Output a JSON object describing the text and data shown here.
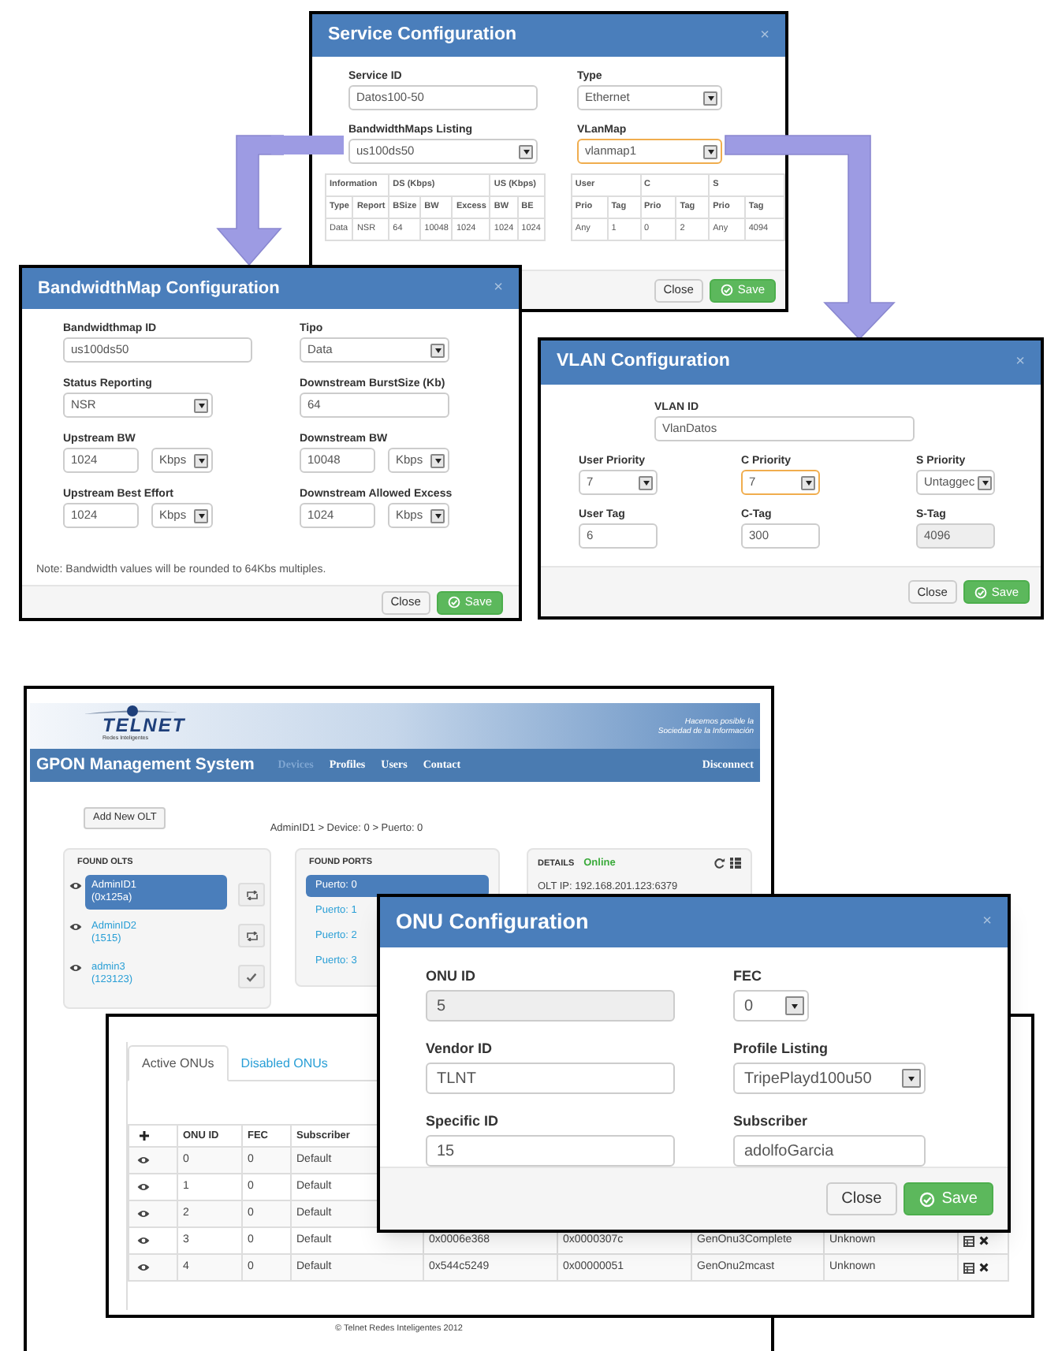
{
  "service_dialog": {
    "title": "Service Configuration",
    "close": "×",
    "fields": [
      {
        "label": "Service ID",
        "value": "Datos100-50",
        "kind": "input",
        "focused": false
      },
      {
        "label": "Type",
        "value": "Ethernet",
        "kind": "select",
        "focused": false
      },
      {
        "label": "BandwidthMaps Listing",
        "value": "us100ds50",
        "kind": "select",
        "focused": false
      },
      {
        "label": "VLanMap",
        "value": "vlanmap1",
        "kind": "select",
        "focused": true
      }
    ],
    "bandwidth_table": {
      "groups": [
        {
          "label": "Information",
          "columns": [
            "Type",
            "Report"
          ]
        },
        {
          "label": "DS (Kbps)",
          "columns": [
            "BSize",
            "BW",
            "Excess"
          ]
        },
        {
          "label": "US (Kbps)",
          "columns": [
            "BW",
            "BE"
          ]
        }
      ],
      "row": [
        "Data",
        "NSR",
        "64",
        "10048",
        "1024",
        "1024",
        "1024"
      ]
    },
    "vlan_table": {
      "groups": [
        {
          "label": "User",
          "columns": [
            "Prio",
            "Tag"
          ]
        },
        {
          "label": "C",
          "columns": [
            "Prio",
            "Tag"
          ]
        },
        {
          "label": "S",
          "columns": [
            "Prio",
            "Tag"
          ]
        }
      ],
      "row": [
        "Any",
        "1",
        "0",
        "2",
        "Any",
        "4094"
      ]
    },
    "buttons": [
      {
        "label": "Close",
        "kind": "default"
      },
      {
        "label": "Save",
        "kind": "primary"
      }
    ]
  },
  "bandwidthmap_dialog": {
    "title": "BandwidthMap Configuration",
    "close": "×",
    "fields": [
      {
        "label": "Bandwidthmap ID",
        "value": "us100ds50",
        "kind": "input"
      },
      {
        "label": "Tipo",
        "value": "Data",
        "kind": "select"
      },
      {
        "label": "Status Reporting",
        "value": "NSR",
        "kind": "select"
      },
      {
        "label": "Downstream BurstSize (Kb)",
        "value": "64",
        "kind": "input"
      },
      {
        "label": "Upstream BW",
        "value": "1024",
        "unit": "Kbps",
        "kind": "input_unit"
      },
      {
        "label": "Downstream BW",
        "value": "10048",
        "unit": "Kbps",
        "kind": "input_unit"
      },
      {
        "label": "Upstream Best Effort",
        "value": "1024",
        "unit": "Kbps",
        "kind": "input_unit"
      },
      {
        "label": "Downstream Allowed Excess",
        "value": "1024",
        "unit": "Kbps",
        "kind": "input_unit"
      }
    ],
    "note": "Note: Bandwidth values will be rounded to 64Kbs multiples.",
    "buttons": [
      {
        "label": "Close",
        "kind": "default"
      },
      {
        "label": "Save",
        "kind": "primary"
      }
    ]
  },
  "vlan_dialog": {
    "title": "VLAN Configuration",
    "close": "×",
    "fields": [
      {
        "label": "VLAN ID",
        "value": "VlanDatos",
        "kind": "input",
        "focused": false,
        "disabled": false
      },
      {
        "label": "User Priority",
        "value": "7",
        "kind": "select",
        "focused": false,
        "disabled": false
      },
      {
        "label": "C Priority",
        "value": "7",
        "kind": "select",
        "focused": true,
        "disabled": false
      },
      {
        "label": "S Priority",
        "value": "Untaggec",
        "kind": "select",
        "focused": false,
        "disabled": false
      },
      {
        "label": "User Tag",
        "value": "6",
        "kind": "input",
        "focused": false,
        "disabled": false
      },
      {
        "label": "C-Tag",
        "value": "300",
        "kind": "input",
        "focused": false,
        "disabled": false
      },
      {
        "label": "S-Tag",
        "value": "4096",
        "kind": "input",
        "focused": false,
        "disabled": true
      }
    ],
    "buttons": [
      {
        "label": "Close",
        "kind": "default"
      },
      {
        "label": "Save",
        "kind": "primary"
      }
    ]
  },
  "gpon_app": {
    "logo": "TELNET",
    "logo_subtitle": "Redes Inteligentes",
    "tagline": [
      "Hacemos posible la",
      "Sociedad de la Información"
    ],
    "brand": "GPON Management System",
    "nav": [
      {
        "label": "Devices",
        "selected": true
      },
      {
        "label": "Profiles",
        "selected": false
      },
      {
        "label": "Users",
        "selected": false
      },
      {
        "label": "Contact",
        "selected": false
      }
    ],
    "disconnect": "Disconnect",
    "add_button": "Add New OLT",
    "breadcrumb": "AdminID1 > Device: 0 > Puerto: 0",
    "found_olts": {
      "title": "FOUND OLTS",
      "items": [
        {
          "name": "AdminID1",
          "id": "(0x125a)",
          "selected": true,
          "kind": "repeat"
        },
        {
          "name": "AdminID2",
          "id": "(1515)",
          "selected": false,
          "kind": "repeat"
        },
        {
          "name": "admin3",
          "id": "(123123)",
          "selected": false,
          "kind": "check"
        }
      ]
    },
    "found_ports": {
      "title": "FOUND PORTS",
      "items": [
        {
          "label": "Puerto: 0",
          "selected": true
        },
        {
          "label": "Puerto: 1",
          "selected": false
        },
        {
          "label": "Puerto: 2",
          "selected": false
        },
        {
          "label": "Puerto: 3",
          "selected": false
        }
      ]
    },
    "details": {
      "title": "DETAILS",
      "status": "Online",
      "olt_ip": "OLT IP: 192.168.201.123:6379"
    },
    "footer": "© Telnet Redes Inteligentes 2012"
  },
  "onu_list": {
    "tabs": [
      {
        "label": "Active ONUs",
        "selected": true
      },
      {
        "label": "Disabled ONUs",
        "selected": false
      }
    ],
    "columns": [
      "ONU ID",
      "FEC",
      "Subscriber"
    ],
    "rows": [
      {
        "onu_id": "0",
        "fec": "0",
        "subscriber": "Default"
      },
      {
        "onu_id": "1",
        "fec": "0",
        "subscriber": "Default"
      },
      {
        "onu_id": "2",
        "fec": "0",
        "subscriber": "Default"
      },
      {
        "onu_id": "3",
        "fec": "0",
        "subscriber": "Default",
        "column_5": "0x0006e368",
        "column_6": "0x0000307c",
        "column_7": "GenOnu3Complete",
        "column_8": "Unknown"
      },
      {
        "onu_id": "4",
        "fec": "0",
        "subscriber": "Default",
        "column_5": "0x544c5249",
        "column_6": "0x00000051",
        "column_7": "GenOnu2mcast",
        "column_8": "Unknown"
      }
    ]
  },
  "onu_dialog": {
    "title": "ONU Configuration",
    "close": "×",
    "fields": [
      {
        "label": "ONU ID",
        "value": "5",
        "kind": "input",
        "disabled": true
      },
      {
        "label": "FEC",
        "value": "0",
        "kind": "select",
        "disabled": false
      },
      {
        "label": "Vendor ID",
        "value": "TLNT",
        "kind": "input",
        "disabled": false
      },
      {
        "label": "Profile Listing",
        "value": "TripePlayd100u50",
        "kind": "select",
        "disabled": false
      },
      {
        "label": "Specific ID",
        "value": "15",
        "kind": "input",
        "disabled": false
      },
      {
        "label": "Subscriber",
        "value": "adolfoGarcia",
        "kind": "input",
        "disabled": false
      }
    ],
    "buttons": [
      {
        "label": "Close",
        "kind": "default"
      },
      {
        "label": "Save",
        "kind": "primary"
      }
    ]
  }
}
